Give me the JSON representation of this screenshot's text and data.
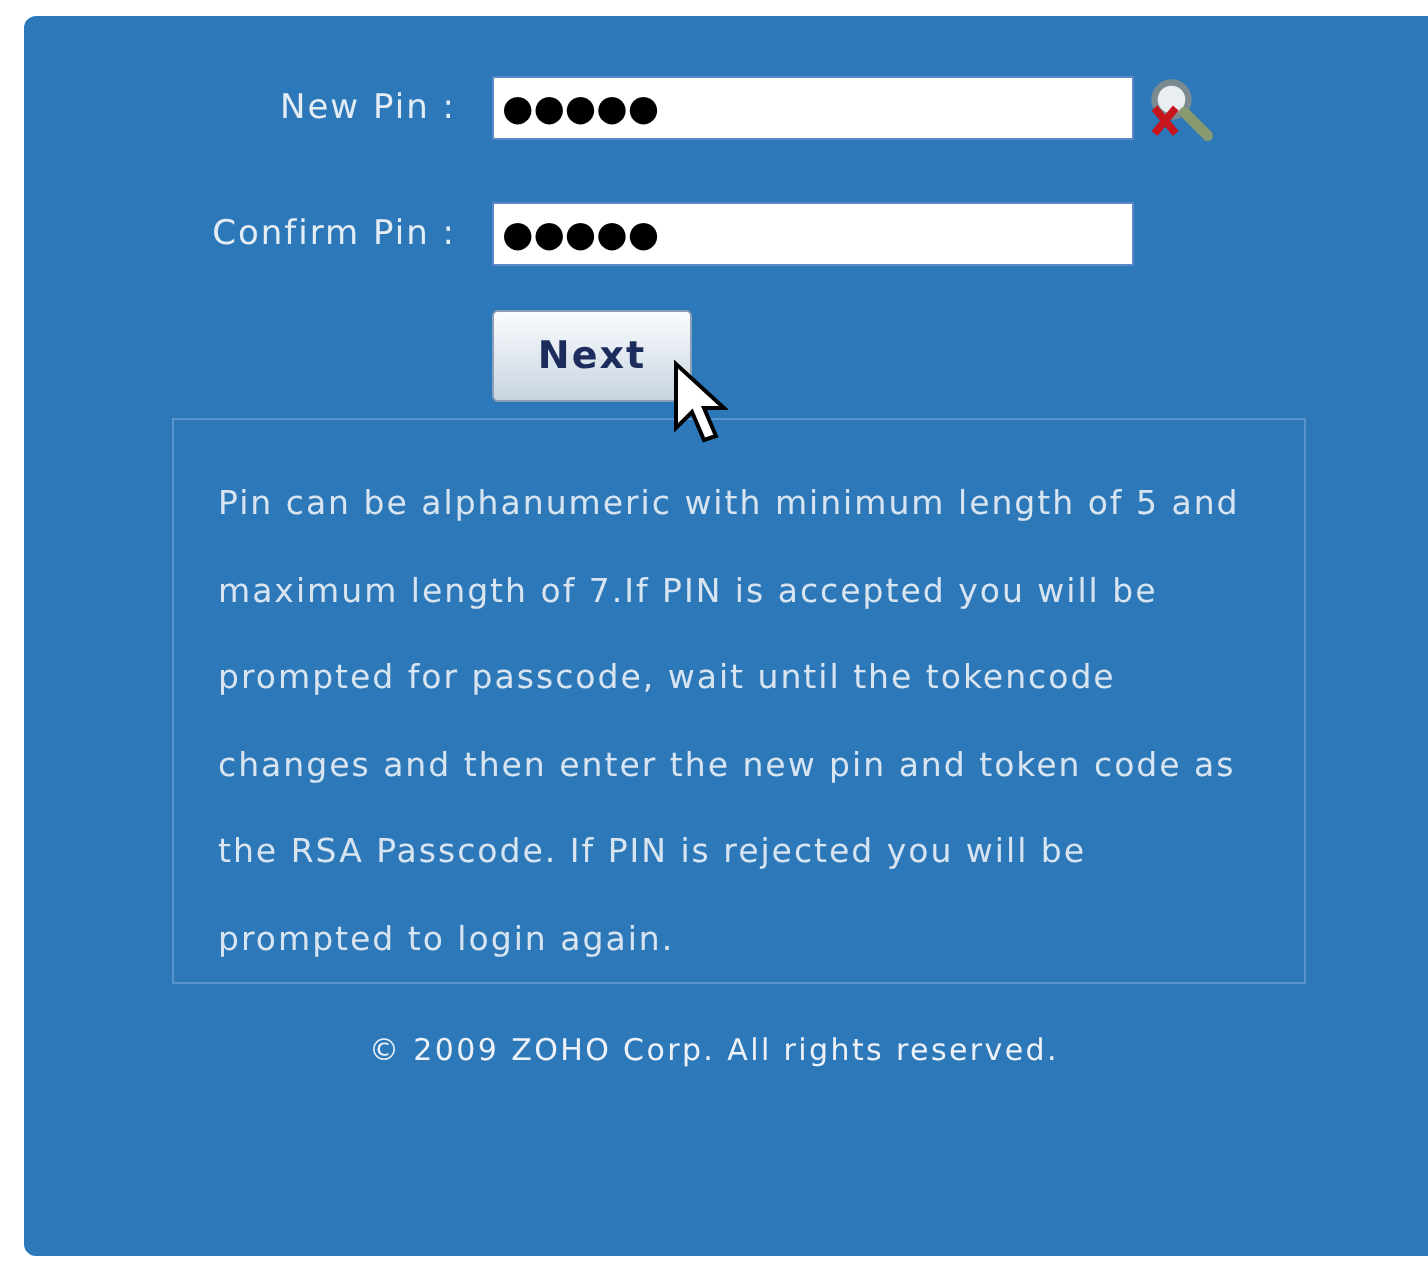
{
  "form": {
    "fields": [
      {
        "label": "New Pin :",
        "value": "●●●●●",
        "kind": "with-icon"
      },
      {
        "label": "Confirm Pin :",
        "value": "●●●●●",
        "kind": "plain"
      }
    ],
    "button": "Next"
  },
  "info": "Pin can be alphanumeric with minimum length of 5 and maximum length of 7.If PIN is accepted you will be prompted for passcode, wait until the tokencode changes and then enter the new pin and token code as the RSA Passcode. If PIN is rejected you will be prompted to login again.",
  "footer": "© 2009 ZOHO Corp. All rights reserved."
}
